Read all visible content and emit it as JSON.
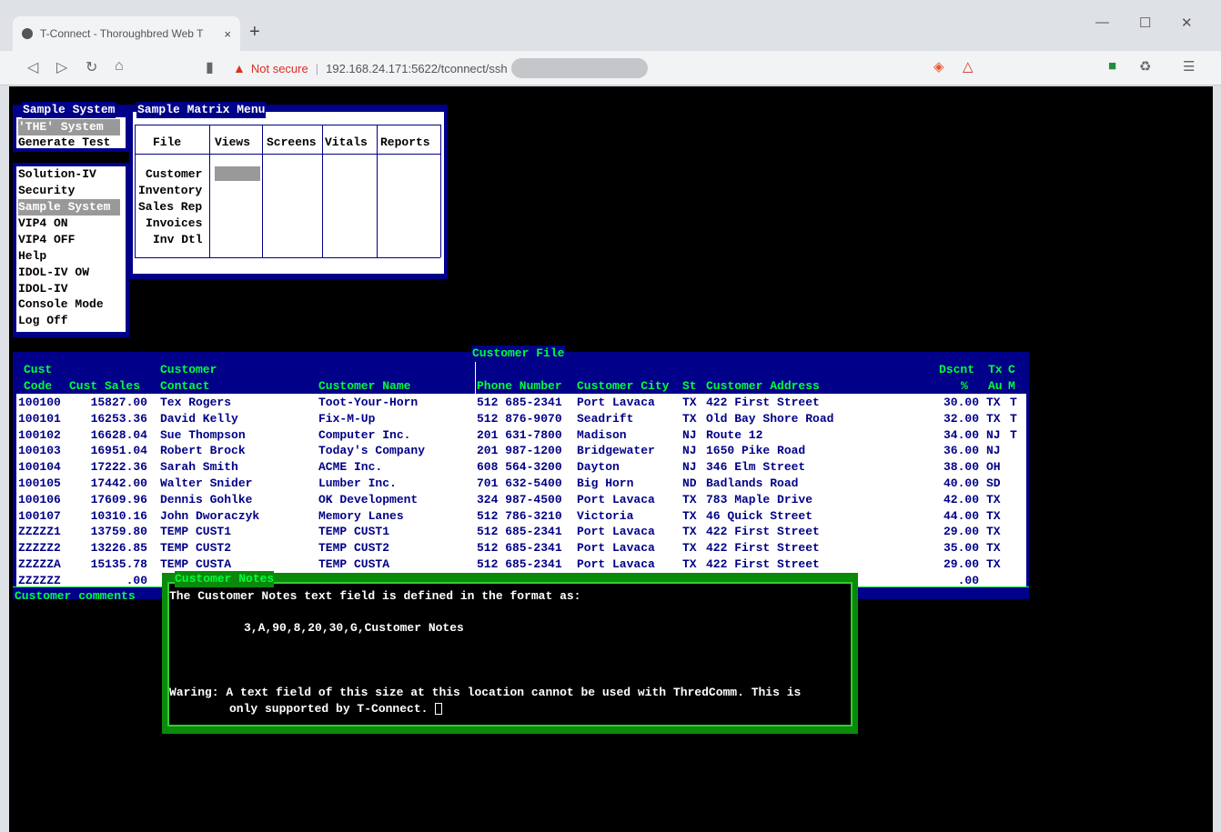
{
  "browser": {
    "tab_title": "T-Connect - Thoroughbred Web T",
    "tab_close": "×",
    "new_tab": "+",
    "not_secure": "Not secure",
    "url": "192.168.24.171:5622/tconnect/ssh",
    "min": "—",
    "max": "☐",
    "close": "✕",
    "menu": "☰"
  },
  "sidebar": {
    "title": "Sample System",
    "top_items": [
      "'THE' System",
      "Generate Test"
    ],
    "items": [
      "Solution-IV",
      "Security",
      "Sample System",
      "VIP4 ON",
      "VIP4 OFF",
      "Help",
      "IDOL-IV OW",
      "IDOL-IV",
      "Console Mode",
      "Log Off"
    ]
  },
  "matrix": {
    "title": "Sample Matrix Menu",
    "headers": [
      "File",
      "Views",
      "Screens",
      "Vitals",
      "Reports"
    ],
    "rows": [
      "Customer",
      "Inventory",
      "Sales Rep",
      "Invoices",
      "Inv Dtl"
    ]
  },
  "customer_file": {
    "title": "Customer File",
    "hdr_cust": "Cust",
    "hdr_code": "Code",
    "hdr_sales": "Cust Sales",
    "hdr_customer": "Customer",
    "hdr_contact": "Contact",
    "hdr_name": "Customer Name",
    "hdr_phone": "Phone Number",
    "hdr_city": "Customer City",
    "hdr_st": "St",
    "hdr_address": "Customer Address",
    "hdr_dscnt": "Dscnt",
    "hdr_pct": "%",
    "hdr_tx": "Tx",
    "hdr_au": "Au",
    "hdr_c": "C",
    "hdr_m": "M",
    "rows": [
      [
        "100100",
        "15827.00",
        "Tex Rogers",
        "Toot-Your-Horn",
        "512 685-2341",
        "Port Lavaca",
        "TX",
        "422 First Street",
        "30.00",
        "TX",
        "T"
      ],
      [
        "100101",
        "16253.36",
        "David Kelly",
        "Fix-M-Up",
        "512 876-9070",
        "Seadrift",
        "TX",
        "Old Bay Shore Road",
        "32.00",
        "TX",
        "T"
      ],
      [
        "100102",
        "16628.04",
        "Sue Thompson",
        "Computer Inc.",
        "201 631-7800",
        "Madison",
        "NJ",
        "Route 12",
        "34.00",
        "NJ",
        "T"
      ],
      [
        "100103",
        "16951.04",
        "Robert Brock",
        "Today's Company",
        "201 987-1200",
        "Bridgewater",
        "NJ",
        "1650 Pike Road",
        "36.00",
        "NJ",
        ""
      ],
      [
        "100104",
        "17222.36",
        "Sarah Smith",
        "ACME Inc.",
        "608 564-3200",
        "Dayton",
        "NJ",
        "346 Elm Street",
        "38.00",
        "OH",
        ""
      ],
      [
        "100105",
        "17442.00",
        "Walter Snider",
        "Lumber Inc.",
        "701 632-5400",
        "Big Horn",
        "ND",
        "Badlands Road",
        "40.00",
        "SD",
        ""
      ],
      [
        "100106",
        "17609.96",
        "Dennis Gohlke",
        "OK Development",
        "324 987-4500",
        "Port Lavaca",
        "TX",
        "783 Maple Drive",
        "42.00",
        "TX",
        ""
      ],
      [
        "100107",
        "10310.16",
        "John Dworaczyk",
        "Memory Lanes",
        "512 786-3210",
        "Victoria",
        "TX",
        "46 Quick Street",
        "44.00",
        "TX",
        ""
      ],
      [
        "ZZZZZ1",
        "13759.80",
        "TEMP CUST1",
        "TEMP CUST1",
        "512 685-2341",
        "Port Lavaca",
        "TX",
        "422 First Street",
        "29.00",
        "TX",
        ""
      ],
      [
        "ZZZZZ2",
        "13226.85",
        "TEMP CUST2",
        "TEMP CUST2",
        "512 685-2341",
        "Port Lavaca",
        "TX",
        "422 First Street",
        "35.00",
        "TX",
        ""
      ],
      [
        "ZZZZZA",
        "15135.78",
        "TEMP CUSTA",
        "TEMP CUSTA",
        "512 685-2341",
        "Port Lavaca",
        "TX",
        "422 First Street",
        "29.00",
        "TX",
        ""
      ],
      [
        "ZZZZZZ",
        ".00",
        "",
        "",
        "",
        "",
        "",
        "",
        ".00",
        "",
        ""
      ]
    ],
    "comments_label": "Customer comments"
  },
  "notes": {
    "title": "Customer Notes",
    "line1": "The Customer Notes text field is defined in the format as:",
    "line2": "3,A,90,8,20,30,G,Customer Notes",
    "line3": "Waring: A text field of this size at this location cannot be used with ThredComm. This is",
    "line4": "only supported by T-Connect."
  }
}
